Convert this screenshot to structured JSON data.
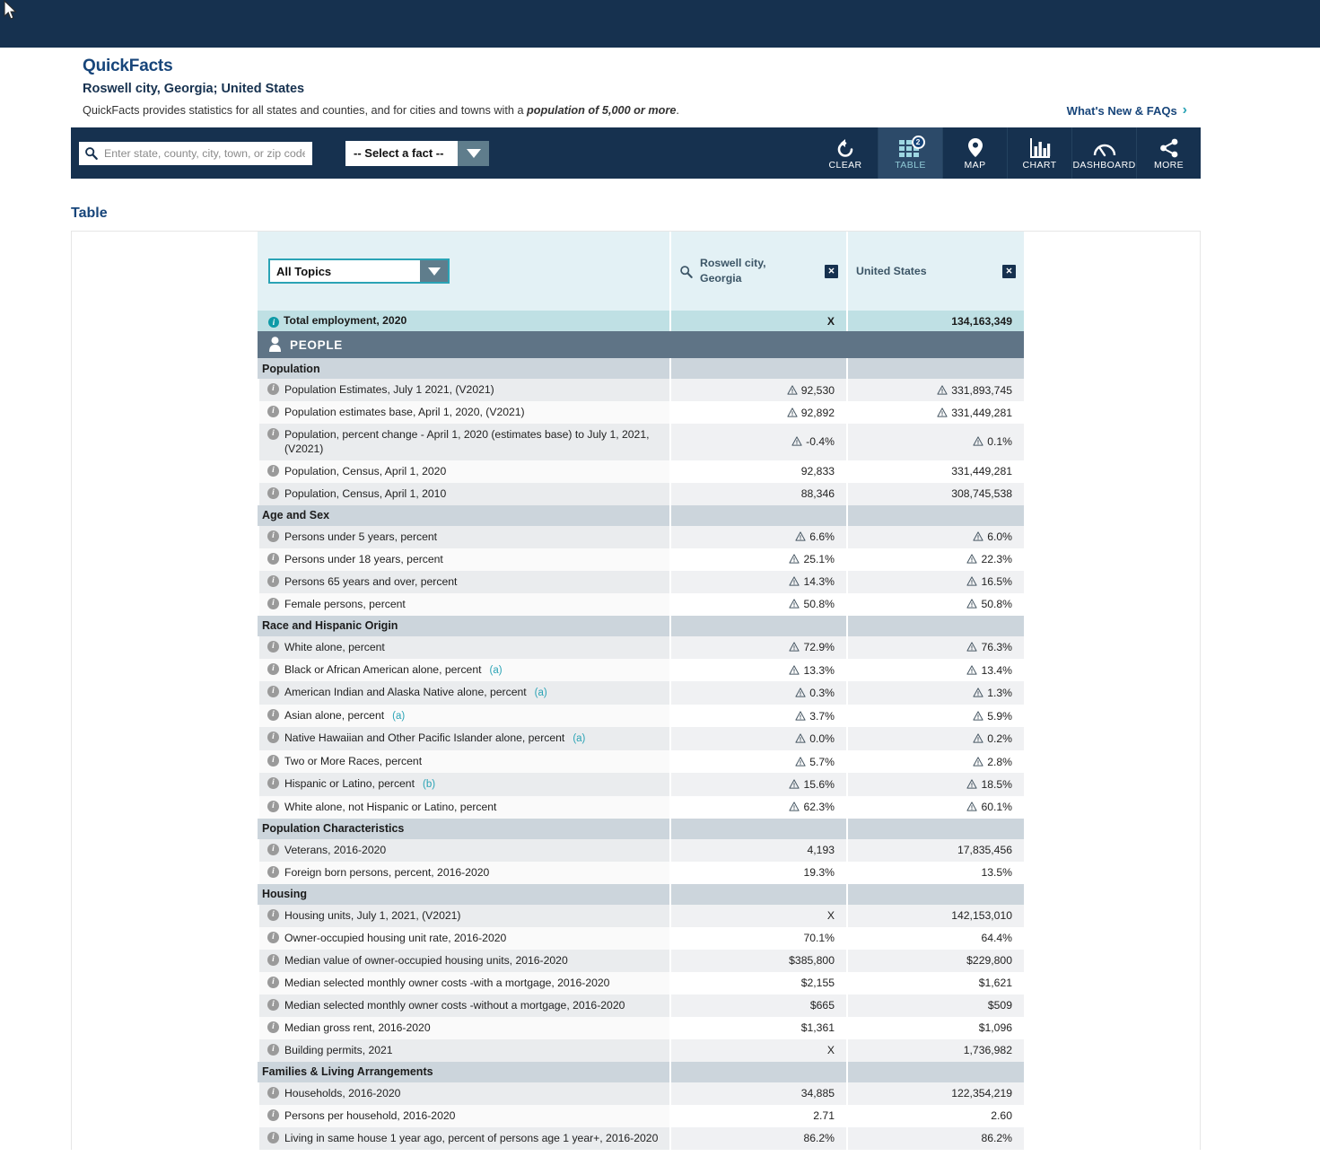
{
  "header": {
    "title": "QuickFacts",
    "subtitle": "Roswell city, Georgia; United States",
    "description_before": "QuickFacts provides statistics for all states and counties, and for cities and towns with a ",
    "description_emphasis": "population of 5,000 or more",
    "description_after": ".",
    "whats_new_label": "What's New & FAQs",
    "chevron_icon": "chevron-right-icon"
  },
  "toolbar": {
    "search_placeholder": "Enter state, county, city, town, or zip code",
    "search_value": "",
    "search_icon": "search-icon",
    "fact_select_label": "-- Select a fact --",
    "tabs": [
      {
        "label": "CLEAR",
        "icon": "undo-icon",
        "active": false,
        "badge": ""
      },
      {
        "label": "TABLE",
        "icon": "grid-icon",
        "active": true,
        "badge": "2"
      },
      {
        "label": "MAP",
        "icon": "map-pin-icon",
        "active": false,
        "badge": ""
      },
      {
        "label": "CHART",
        "icon": "bar-chart-icon",
        "active": false,
        "badge": ""
      },
      {
        "label": "DASHBOARD",
        "icon": "gauge-icon",
        "active": false,
        "badge": ""
      },
      {
        "label": "MORE",
        "icon": "share-icon",
        "active": false,
        "badge": ""
      }
    ]
  },
  "section_title": "Table",
  "table": {
    "topic_select_label": "All Topics",
    "columns": [
      {
        "name": "Roswell city, Georgia",
        "has_search_icon": true,
        "close_icon": "close-icon"
      },
      {
        "name": "United States",
        "has_search_icon": false,
        "close_icon": "close-icon"
      }
    ],
    "total_employment": {
      "label": "Total employment, 2020",
      "values": [
        "X",
        "134,163,349"
      ]
    },
    "people_banner": "PEOPLE",
    "rows": [
      {
        "type": "group",
        "label": "Population"
      },
      {
        "type": "data",
        "label": "Population Estimates, July 1 2021, (V2021)",
        "values": [
          "92,530",
          "331,893,745"
        ],
        "warn": [
          true,
          true
        ]
      },
      {
        "type": "data",
        "label": "Population estimates base, April 1, 2020, (V2021)",
        "values": [
          "92,892",
          "331,449,281"
        ],
        "warn": [
          true,
          true
        ]
      },
      {
        "type": "data",
        "label": "Population, percent change - April 1, 2020 (estimates base) to July 1, 2021, (V2021)",
        "values": [
          "-0.4%",
          "0.1%"
        ],
        "warn": [
          true,
          true
        ],
        "tall": true
      },
      {
        "type": "data",
        "label": "Population, Census, April 1, 2020",
        "values": [
          "92,833",
          "331,449,281"
        ],
        "warn": [
          false,
          false
        ]
      },
      {
        "type": "data",
        "label": "Population, Census, April 1, 2010",
        "values": [
          "88,346",
          "308,745,538"
        ],
        "warn": [
          false,
          false
        ]
      },
      {
        "type": "group",
        "label": "Age and Sex"
      },
      {
        "type": "data",
        "label": "Persons under 5 years, percent",
        "values": [
          "6.6%",
          "6.0%"
        ],
        "warn": [
          true,
          true
        ]
      },
      {
        "type": "data",
        "label": "Persons under 18 years, percent",
        "values": [
          "25.1%",
          "22.3%"
        ],
        "warn": [
          true,
          true
        ]
      },
      {
        "type": "data",
        "label": "Persons 65 years and over, percent",
        "values": [
          "14.3%",
          "16.5%"
        ],
        "warn": [
          true,
          true
        ]
      },
      {
        "type": "data",
        "label": "Female persons, percent",
        "values": [
          "50.8%",
          "50.8%"
        ],
        "warn": [
          true,
          true
        ]
      },
      {
        "type": "group",
        "label": "Race and Hispanic Origin"
      },
      {
        "type": "data",
        "label": "White alone, percent",
        "values": [
          "72.9%",
          "76.3%"
        ],
        "warn": [
          true,
          true
        ]
      },
      {
        "type": "data",
        "label": "Black or African American alone, percent",
        "footnote": "(a)",
        "values": [
          "13.3%",
          "13.4%"
        ],
        "warn": [
          true,
          true
        ]
      },
      {
        "type": "data",
        "label": "American Indian and Alaska Native alone, percent",
        "footnote": "(a)",
        "values": [
          "0.3%",
          "1.3%"
        ],
        "warn": [
          true,
          true
        ]
      },
      {
        "type": "data",
        "label": "Asian alone, percent",
        "footnote": "(a)",
        "values": [
          "3.7%",
          "5.9%"
        ],
        "warn": [
          true,
          true
        ]
      },
      {
        "type": "data",
        "label": "Native Hawaiian and Other Pacific Islander alone, percent",
        "footnote": "(a)",
        "values": [
          "0.0%",
          "0.2%"
        ],
        "warn": [
          true,
          true
        ]
      },
      {
        "type": "data",
        "label": "Two or More Races, percent",
        "values": [
          "5.7%",
          "2.8%"
        ],
        "warn": [
          true,
          true
        ]
      },
      {
        "type": "data",
        "label": "Hispanic or Latino, percent",
        "footnote": "(b)",
        "values": [
          "15.6%",
          "18.5%"
        ],
        "warn": [
          true,
          true
        ]
      },
      {
        "type": "data",
        "label": "White alone, not Hispanic or Latino, percent",
        "values": [
          "62.3%",
          "60.1%"
        ],
        "warn": [
          true,
          true
        ]
      },
      {
        "type": "group",
        "label": "Population Characteristics"
      },
      {
        "type": "data",
        "label": "Veterans, 2016-2020",
        "values": [
          "4,193",
          "17,835,456"
        ],
        "warn": [
          false,
          false
        ]
      },
      {
        "type": "data",
        "label": "Foreign born persons, percent, 2016-2020",
        "values": [
          "19.3%",
          "13.5%"
        ],
        "warn": [
          false,
          false
        ]
      },
      {
        "type": "group",
        "label": "Housing"
      },
      {
        "type": "data",
        "label": "Housing units, July 1, 2021, (V2021)",
        "values": [
          "X",
          "142,153,010"
        ],
        "warn": [
          false,
          false
        ]
      },
      {
        "type": "data",
        "label": "Owner-occupied housing unit rate, 2016-2020",
        "values": [
          "70.1%",
          "64.4%"
        ],
        "warn": [
          false,
          false
        ]
      },
      {
        "type": "data",
        "label": "Median value of owner-occupied housing units, 2016-2020",
        "values": [
          "$385,800",
          "$229,800"
        ],
        "warn": [
          false,
          false
        ]
      },
      {
        "type": "data",
        "label": "Median selected monthly owner costs -with a mortgage, 2016-2020",
        "values": [
          "$2,155",
          "$1,621"
        ],
        "warn": [
          false,
          false
        ]
      },
      {
        "type": "data",
        "label": "Median selected monthly owner costs -without a mortgage, 2016-2020",
        "values": [
          "$665",
          "$509"
        ],
        "warn": [
          false,
          false
        ]
      },
      {
        "type": "data",
        "label": "Median gross rent, 2016-2020",
        "values": [
          "$1,361",
          "$1,096"
        ],
        "warn": [
          false,
          false
        ]
      },
      {
        "type": "data",
        "label": "Building permits, 2021",
        "values": [
          "X",
          "1,736,982"
        ],
        "warn": [
          false,
          false
        ]
      },
      {
        "type": "group",
        "label": "Families & Living Arrangements"
      },
      {
        "type": "data",
        "label": "Households, 2016-2020",
        "values": [
          "34,885",
          "122,354,219"
        ],
        "warn": [
          false,
          false
        ]
      },
      {
        "type": "data",
        "label": "Persons per household, 2016-2020",
        "values": [
          "2.71",
          "2.60"
        ],
        "warn": [
          false,
          false
        ]
      },
      {
        "type": "data",
        "label": "Living in same house 1 year ago, percent of persons age 1 year+, 2016-2020",
        "values": [
          "86.2%",
          "86.2%"
        ],
        "warn": [
          false,
          false
        ]
      }
    ]
  },
  "colors": {
    "navy": "#16314f",
    "teal": "#2aa3b5",
    "link_blue": "#17457a",
    "header_bg": "#e3f1f5",
    "total_row_bg": "#bfe0e4",
    "people_banner_bg": "#5f7486",
    "group_bg": "#ccd5dc"
  }
}
